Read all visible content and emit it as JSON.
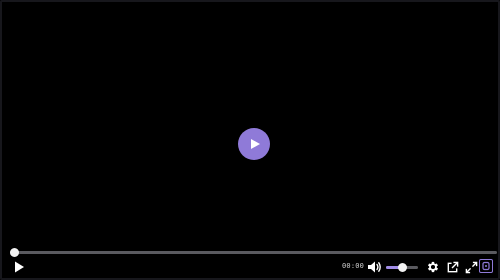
{
  "player": {
    "time_display": "00:00",
    "progress": 0,
    "volume": 0.5,
    "accent_color": "#8f7ad8",
    "icons": {
      "big_play": "play-icon",
      "play": "play-icon",
      "volume": "volume-icon",
      "settings": "gear-icon",
      "popout": "external-link-icon",
      "fullscreen": "fullscreen-icon",
      "plugin": "plugin-icon"
    }
  }
}
